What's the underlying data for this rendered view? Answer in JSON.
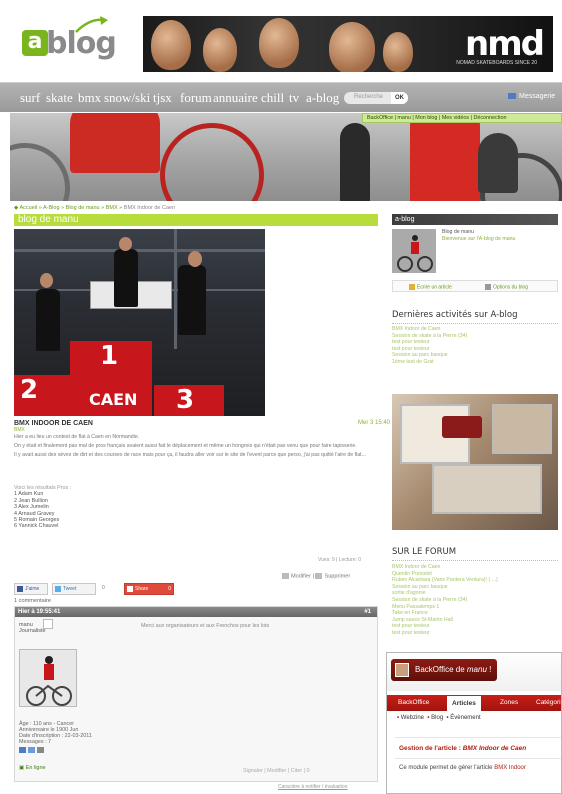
{
  "header": {
    "logo_letter": "a",
    "logo_word": "blog",
    "banner_brand": "nmd",
    "banner_tagline": "NOMAD SKATEBOARDS SINCE 20"
  },
  "nav": {
    "items": [
      "surf",
      "skate",
      "bmx",
      "snow/ski",
      "tjsx",
      "forum",
      "annuaire",
      "chill",
      "tv",
      "a-blog"
    ],
    "search_placeholder": "Recherche",
    "search_ok": "OK",
    "messagerie": "Messagerie"
  },
  "backoffice_bar": "BackOffice | manu | Mon blog | Mes vidéos | Déconnection",
  "breadcrumb": {
    "items": [
      "Accueil",
      "A-Blog",
      "Blog de manu",
      "BMX"
    ],
    "current": "BMX Indoor de Caen"
  },
  "blog_title": "blog de manu",
  "post": {
    "title": "BMX INDOOR DE CAEN",
    "category": "BMX",
    "date": "Mer 3 15:40",
    "paragraphs": [
      "Hier a eu lieu un contest de flat à Caen en Normandie.",
      "On y était et finalement pas mal de pros français avaient aussi fait le déplacement et même un hongrois qui n'était pas venu que pour faire tapisserie.",
      "Il y avait aussi des sèves de dirt et des courses de race mais pour ça, il faudra aller voir sur le site de l'event parce que perso, j'ai pas quitté l'aire de flat..."
    ],
    "results_heading": "Voici les résultats Pros :",
    "results": [
      "1 Adam Kun",
      "2 Jean Bullion",
      "3 Alex Jumelin",
      "4 Arnaud Gravey",
      "5 Romain Georges",
      "6 Yannick Chauvel"
    ],
    "views": "Vues: 9 | Lecture: 0",
    "edit_label": "Modifier",
    "delete_label": "Supprimer",
    "photo_numbers": [
      "1",
      "2",
      "3"
    ],
    "photo_banner": "CAEN"
  },
  "social": {
    "like_label": "J'aime",
    "like_count": "0",
    "tweet_label": "Tweet",
    "tweet_count": "0",
    "share_label": "Share",
    "share_count": "0"
  },
  "comments_count": "1 commentaire",
  "comment": {
    "date": "Hier à 19:55:41",
    "number": "#1",
    "author": "manu",
    "role": "Journaliste",
    "text": "Merci aux organisateurs et aux Frenchos pour les lots",
    "stats": [
      "Âge : 110 ans - Cancer",
      "Anniversaire le 1900 Jun",
      "Date d'inscription : 22-03-2011",
      "Messages : 7"
    ],
    "online": "En ligne",
    "actions": "Signaler | Modifier | Citer | 0"
  },
  "report_link": "Caractère à notifier / évaluation",
  "sidebar": {
    "ablog_title": "a-blog",
    "ablog_name": "Blog de manu",
    "ablog_welcome": "Bienvenue sur l'A-blog de manu",
    "write_article": "Écrire un article",
    "blog_options": "Options du blog",
    "activity_heading": "Dernières activités sur A-blog",
    "activity_items": [
      "BMX Indoor de Caen",
      "Session de skate à la Pierre (34)",
      "test pour testeur",
      "test pour testeur",
      "Session au parc basque",
      "1ème test de Grat"
    ],
    "forum_heading": "SUR LE FORUM",
    "forum_items": [
      "BMX Indoor de Caen",
      "Quentin Poncelet",
      "Ruben Alcantara (Vans Pantera Ventura)! ( ...)",
      "Session au parc basque",
      "sortie d'agonie",
      "Session de skate à la Pierre (34)",
      "Menu Passatemps 1",
      "Take en France",
      "Jump sauce St-Martin Hall",
      "test pour testeur",
      "test pour testeur"
    ]
  },
  "backoffice": {
    "title_prefix": "BackOffice de ",
    "title_user": "manu",
    "title_suffix": " !",
    "tabs": [
      "BackOffice",
      "Articles",
      "Zones",
      "Catégories"
    ],
    "active_tab": "Articles",
    "sub_items": [
      "Webzine",
      "Blog",
      "Évènement"
    ],
    "gestion_prefix": "Gestion de l'article : ",
    "gestion_article": "BMX Indoor de Caen",
    "desc_prefix": "Ce module permet de gérer l'article ",
    "desc_article": "BMX Indoor"
  },
  "colors": {
    "accent_green": "#b7dd3c",
    "nav_grey": "#a3a3a3",
    "backoffice_red": "#b01c10"
  }
}
